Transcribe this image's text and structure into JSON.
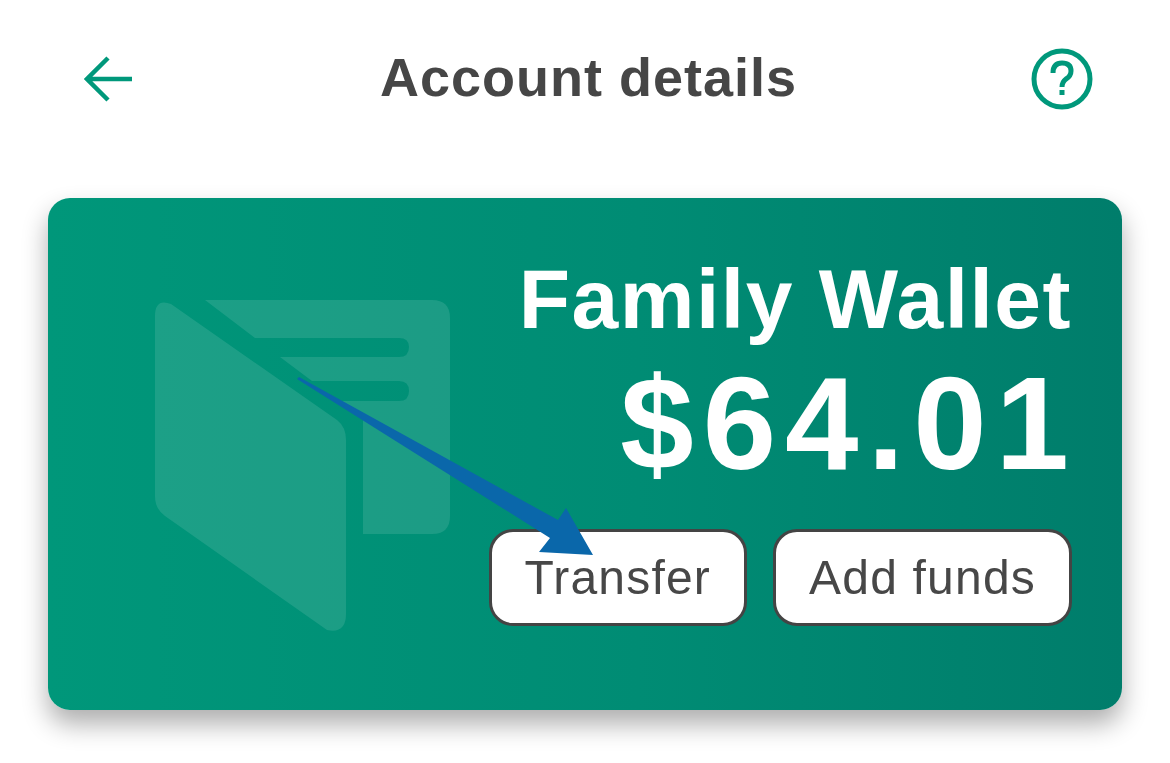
{
  "header": {
    "title": "Account details"
  },
  "account": {
    "name": "Family Wallet",
    "balance": "$64.01"
  },
  "actions": [
    {
      "label": "Transfer"
    },
    {
      "label": "Add funds"
    }
  ]
}
